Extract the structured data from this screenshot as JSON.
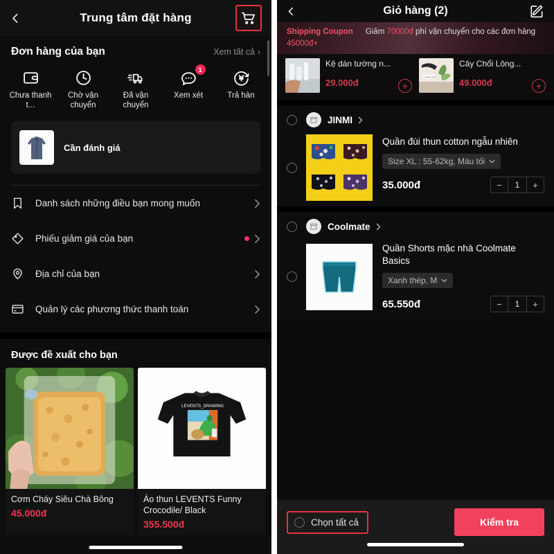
{
  "left": {
    "header": {
      "back_icon": "chevron-left-icon",
      "title": "Trung tâm đặt hàng",
      "cart_icon": "shopping-cart-icon"
    },
    "orders": {
      "section_title": "Đơn hàng của bạn",
      "view_all": "Xem tất cả",
      "chevron": "›",
      "statuses": [
        {
          "icon": "wallet-icon",
          "label": "Chưa thanh t...",
          "badge": ""
        },
        {
          "icon": "clock-icon",
          "label": "Chờ vận chuyển",
          "badge": ""
        },
        {
          "icon": "truck-icon",
          "label": "Đã vận chuyển",
          "badge": ""
        },
        {
          "icon": "comment-dots-icon",
          "label": "Xem xét",
          "badge": "1"
        },
        {
          "icon": "yen-refund-icon",
          "label": "Trả hàn",
          "badge": ""
        }
      ]
    },
    "review_card": {
      "label": "Cần đánh giá",
      "thumb": "jacket-thumbnail"
    },
    "menu": [
      {
        "icon": "bookmark-icon",
        "label": "Danh sách những điều bạn mong muốn",
        "dot": false
      },
      {
        "icon": "coupon-tag-icon",
        "label": "Phiếu giảm giá của bạn",
        "dot": true
      },
      {
        "icon": "location-pin-icon",
        "label": "Địa chỉ của bạn",
        "dot": false
      },
      {
        "icon": "credit-card-icon",
        "label": "Quản lý các phương thức thanh toán",
        "dot": false
      }
    ],
    "recommend": {
      "title": "Được đề xuất cho bạn",
      "items": [
        {
          "name": "Cơm Cháy Siêu Chà Bông",
          "price": "45.000đ",
          "image": "rice-crisp-photo"
        },
        {
          "name": "Áo thun LEVENTS Funny Crocodile/ Black",
          "price": "355.500đ",
          "image": "black-tshirt-photo"
        }
      ]
    }
  },
  "right": {
    "header": {
      "back_icon": "chevron-left-icon",
      "title": "Giỏ hàng (2)",
      "edit_icon": "edit-pencil-icon"
    },
    "coupon": {
      "tag": "Shipping Coupon",
      "text_pre": "Giảm ",
      "amount": "70000đ",
      "text_mid": " phí vận chuyển cho các đơn hàng ",
      "amount2": "45000đ+",
      "products": [
        {
          "name": "Kệ dán tường n...",
          "price": "29.000đ",
          "add_icon": "plus-circle-icon",
          "image": "wall-shelf-photo"
        },
        {
          "name": "Cây Chổi Lông...",
          "price": "49.000đ",
          "add_icon": "plus-circle-icon",
          "image": "feather-duster-photo"
        }
      ]
    },
    "shops": [
      {
        "name": "JINMI",
        "avatar_icon": "store-icon",
        "chevron": "›",
        "product": {
          "name": "Quần đùi thun cotton ngẫu nhiên",
          "variant": "Size XL : 55-62kg, Màu tối",
          "variant_chevron_icon": "chevron-down-icon",
          "price": "35.000đ",
          "qty": "1",
          "minus": "−",
          "plus": "+",
          "image": "boxer-shorts-grid-photo"
        }
      },
      {
        "name": "Coolmate",
        "avatar_icon": "store-icon",
        "chevron": "›",
        "product": {
          "name": "Quần Shorts mặc nhà Coolmate Basics",
          "variant": "Xanh thép, M",
          "variant_chevron_icon": "chevron-down-icon",
          "price": "65.550đ",
          "qty": "1",
          "minus": "−",
          "plus": "+",
          "image": "teal-shorts-photo"
        }
      }
    ],
    "bottom": {
      "select_all": "Chọn tất cả",
      "checkout": "Kiểm tra"
    }
  },
  "colors": {
    "accent_red": "#e8313f",
    "price_red": "#ef3653",
    "badge_pink": "#f0275a",
    "checkout_pink": "#f1415d"
  }
}
